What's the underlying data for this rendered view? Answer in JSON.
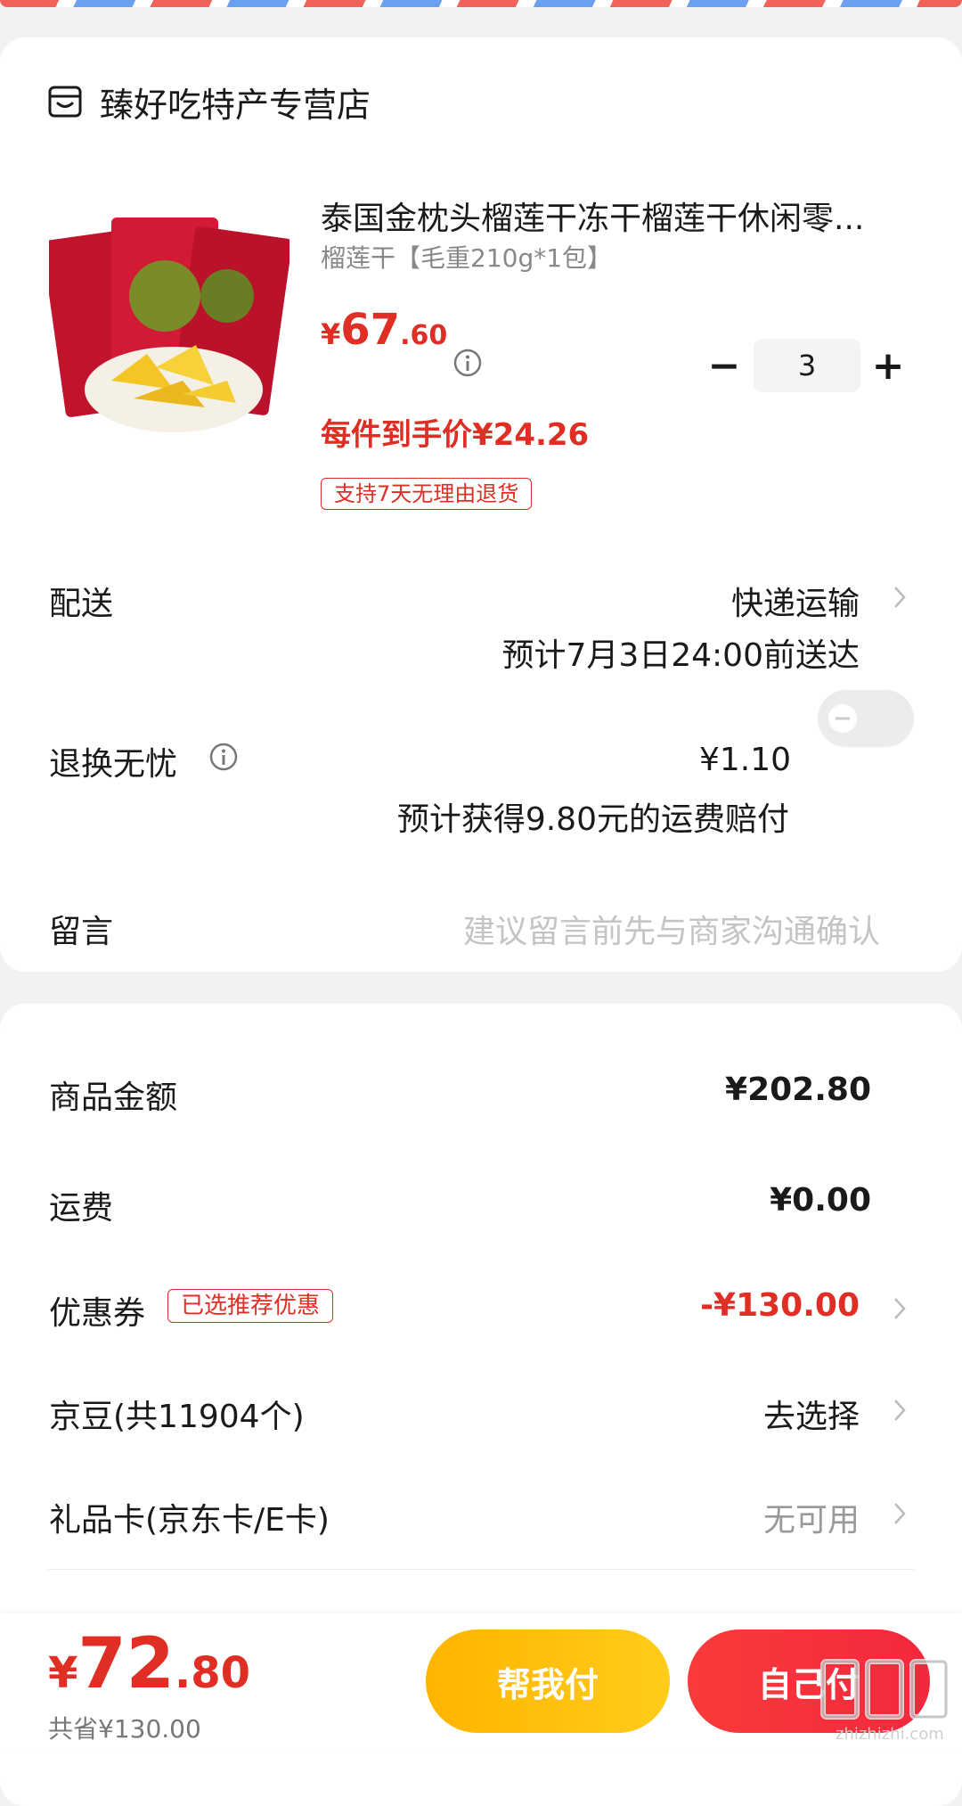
{
  "shop": {
    "name": "臻好吃特产专营店",
    "icon": "store-icon"
  },
  "product": {
    "title": "泰国金枕头榴莲干冻干榴莲干休闲零...",
    "spec": "榴莲干【毛重210g*1包】",
    "price_currency": "¥",
    "price_int": "67",
    "price_dec": ".60",
    "unit_price": "每件到手价¥24.26",
    "return_tag": "支持7天无理由退货",
    "quantity": "3",
    "minus": "−",
    "plus": "+"
  },
  "delivery": {
    "label": "配送",
    "method": "快递运输",
    "eta": "预计7月3日24:00前送达"
  },
  "worry_free": {
    "label": "退换无忧",
    "price": "¥1.10",
    "note": "预计获得9.80元的运费赔付",
    "enabled": false
  },
  "message": {
    "label": "留言",
    "placeholder": "建议留言前先与商家沟通确认"
  },
  "summary": {
    "goods_label": "商品金额",
    "goods_value": "¥202.80",
    "shipping_label": "运费",
    "shipping_value": "¥0.00",
    "coupon_label": "优惠券",
    "coupon_tag": "已选推荐优惠",
    "coupon_value": "-¥130.00",
    "jd_beans_label": "京豆(共11904个)",
    "jd_beans_value": "去选择",
    "gift_card_label": "礼品卡(京东卡/E卡)",
    "gift_card_value": "无可用"
  },
  "bottom": {
    "total_currency": "¥",
    "total_int": "72",
    "total_dec": ".80",
    "saved": "共省¥130.00",
    "help_pay": "帮我付",
    "self_pay": "自己付"
  },
  "watermark": {
    "text": "zhizhizhi.com"
  },
  "colors": {
    "accent": "#e02e24",
    "yellow": "#ffb400",
    "red_button": "#f2283c"
  }
}
